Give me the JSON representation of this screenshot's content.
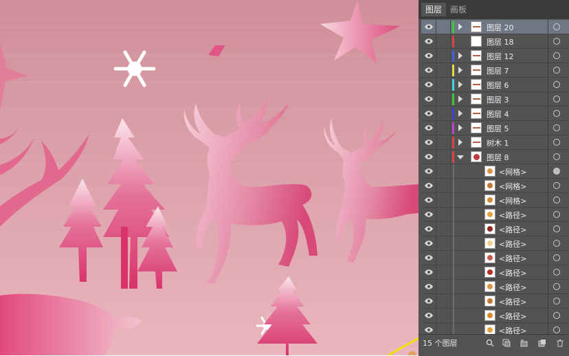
{
  "panel": {
    "tabs": [
      {
        "label": "图层",
        "active": true
      },
      {
        "label": "画板",
        "active": false
      }
    ],
    "layers": [
      {
        "name": "图层 20",
        "color": "#3cc83c",
        "expandable": true,
        "expanded": false,
        "selected": true,
        "level": 0
      },
      {
        "name": "图层 18",
        "color": "#e04040",
        "expandable": false,
        "expanded": false,
        "selected": false,
        "level": 0
      },
      {
        "name": "图层 12",
        "color": "#4060e0",
        "expandable": true,
        "expanded": false,
        "selected": false,
        "level": 0
      },
      {
        "name": "图层 7",
        "color": "#e0e040",
        "expandable": true,
        "expanded": false,
        "selected": false,
        "level": 0
      },
      {
        "name": "图层 6",
        "color": "#40d8e0",
        "expandable": true,
        "expanded": false,
        "selected": false,
        "level": 0
      },
      {
        "name": "图层 3",
        "color": "#3cc83c",
        "expandable": true,
        "expanded": false,
        "selected": false,
        "level": 0
      },
      {
        "name": "图层 4",
        "color": "#4040d0",
        "expandable": true,
        "expanded": false,
        "selected": false,
        "level": 0
      },
      {
        "name": "图层 5",
        "color": "#c040d0",
        "expandable": true,
        "expanded": false,
        "selected": false,
        "level": 0
      },
      {
        "name": "树木 1",
        "color": "#e04040",
        "expandable": true,
        "expanded": false,
        "selected": false,
        "level": 0
      },
      {
        "name": "图层 8",
        "color": "#e04040",
        "expandable": true,
        "expanded": true,
        "selected": false,
        "level": 0
      },
      {
        "name": "<网格>",
        "color": "#e04040",
        "level": 1,
        "target_filled": true
      },
      {
        "name": "<网格>",
        "color": "#e04040",
        "level": 1
      },
      {
        "name": "<网格>",
        "color": "#e04040",
        "level": 1
      },
      {
        "name": "<路径>",
        "color": "#e04040",
        "level": 1
      },
      {
        "name": "<路径>",
        "color": "#e04040",
        "level": 1
      },
      {
        "name": "<路径>",
        "color": "#e04040",
        "level": 1
      },
      {
        "name": "<路径>",
        "color": "#e04040",
        "level": 1
      },
      {
        "name": "<路径>",
        "color": "#e04040",
        "level": 1
      },
      {
        "name": "<路径>",
        "color": "#e04040",
        "level": 1
      },
      {
        "name": "<路径>",
        "color": "#e04040",
        "level": 1
      },
      {
        "name": "<路径>",
        "color": "#e04040",
        "level": 1
      },
      {
        "name": "<路径>",
        "color": "#e04040",
        "level": 1
      }
    ],
    "status": "15 个图层",
    "bottom_icons": [
      "search-icon",
      "make-clipping-mask-icon",
      "new-sublayer-icon",
      "new-layer-icon",
      "trash-icon"
    ]
  },
  "colors": {
    "canvas_top": "#cf8f98",
    "canvas_bottom": "#eab5bd",
    "panel_bg": "#535353",
    "selected_row": "#6f7785",
    "accent_pink": "#d9336b"
  }
}
